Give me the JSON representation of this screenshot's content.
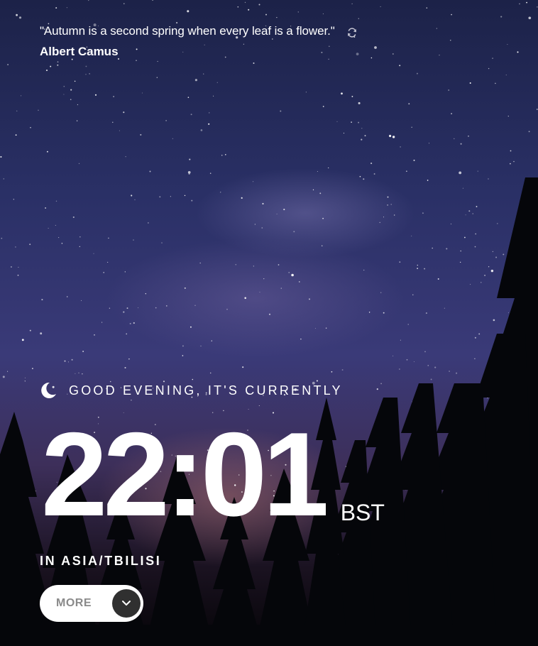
{
  "quote": {
    "text": "\"Autumn is a second spring when every leaf is a flower.\"",
    "author": "Albert Camus",
    "refresh_icon": "refresh-icon"
  },
  "greeting": {
    "icon": "moon-icon",
    "text": "GOOD EVENING, IT'S CURRENTLY"
  },
  "clock": {
    "time": "22:01",
    "timezone": "BST"
  },
  "location": {
    "text": "IN ASIA/TBILISI"
  },
  "more_button": {
    "label": "MORE",
    "icon": "chevron-down-icon"
  },
  "colors": {
    "text": "#ffffff",
    "button_bg": "#ffffff",
    "button_label": "#8a8a8a",
    "button_circle": "#303030"
  }
}
